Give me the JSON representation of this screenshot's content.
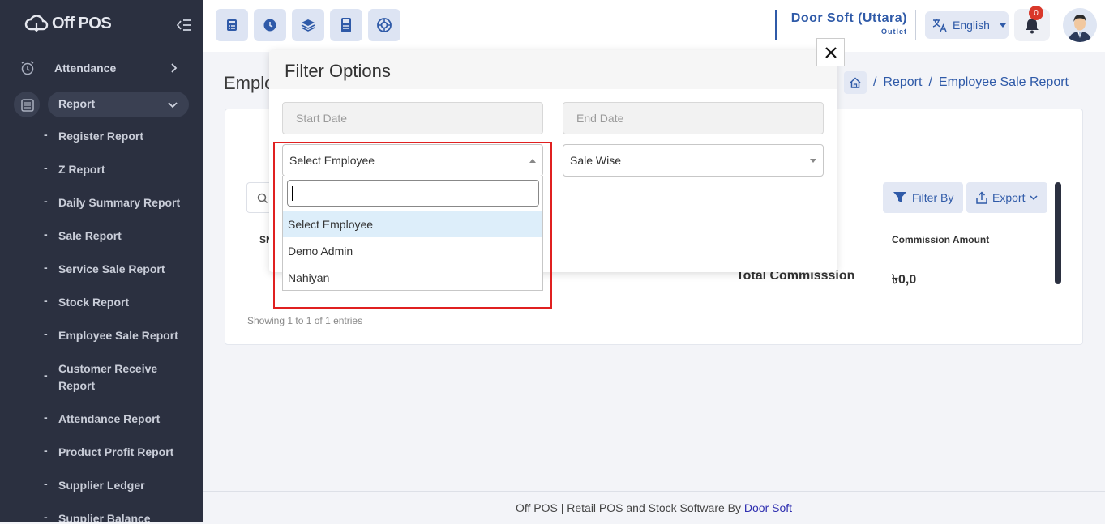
{
  "sidebar": {
    "logo_text": "Off POS",
    "top_items": [
      {
        "label": "Attendance"
      },
      {
        "label": "Report"
      }
    ],
    "report_sub_items": [
      "Register Report",
      "Z Report",
      "Daily Summary Report",
      "Sale Report",
      "Service Sale Report",
      "Stock Report",
      "Employee Sale Report",
      "Customer Receive Report",
      "Attendance Report",
      "Product Profit Report",
      "Supplier Ledger",
      "Supplier Balance Report"
    ]
  },
  "topbar": {
    "outlet_name": "Door Soft (Uttara)",
    "outlet_sub": "Outlet",
    "language": "English",
    "notification_count": "0"
  },
  "page": {
    "title": "Employee Sale Report",
    "breadcrumb": [
      "Report",
      "Employee Sale Report"
    ],
    "filter_label": "Filter By",
    "export_label": "Export",
    "th_sn": "SN",
    "th_commission": "Commission Amount",
    "total_label": "Total Commisssion",
    "total_value": "৳0,0",
    "showing": "Showing 1 to 1 of 1 entries"
  },
  "modal": {
    "title": "Filter Options",
    "start_date_placeholder": "Start Date",
    "end_date_placeholder": "End Date",
    "employee_select_value": "Select Employee",
    "type_select_value": "Sale Wise",
    "dropdown_options": [
      "Select Employee",
      "Demo Admin",
      "Nahiyan"
    ]
  },
  "footer": {
    "text": "Off POS | Retail POS and Stock Software By ",
    "link": "Door Soft"
  }
}
